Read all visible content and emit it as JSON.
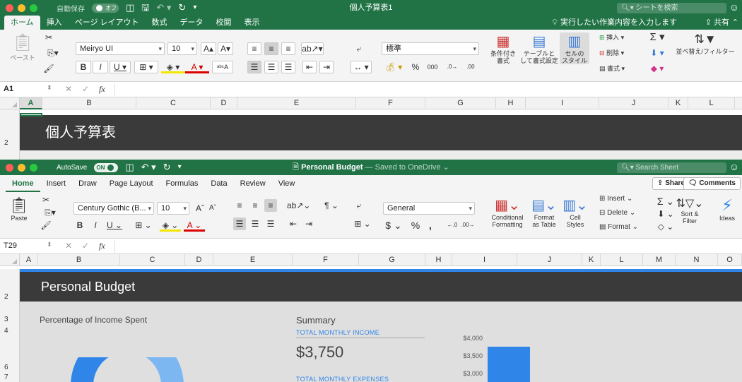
{
  "window_jp": {
    "autosave_label": "自動保存",
    "autosave_state": "オフ",
    "title": "個人予算表1",
    "search_placeholder": "シートを検索",
    "tabs": [
      "ホーム",
      "挿入",
      "ページ レイアウト",
      "数式",
      "データ",
      "校閲",
      "表示"
    ],
    "tell_me": "実行したい作業内容を入力します",
    "share": "共有",
    "ribbon": {
      "paste": "ペースト",
      "font_name": "Meiryo UI",
      "font_size": "10",
      "number_format": "標準",
      "percent": "%",
      "thousands": "000",
      "cond_format": [
        "条件付き",
        "書式"
      ],
      "format_table": [
        "テーブルと",
        "して書式設定"
      ],
      "cell_styles": [
        "セルの",
        "スタイル"
      ],
      "insert": "挿入",
      "delete": "削除",
      "format": "書式",
      "sort_filter": "並べ替え/フィルター"
    },
    "name_box": "A1",
    "columns": [
      "A",
      "B",
      "C",
      "D",
      "E",
      "F",
      "G",
      "H",
      "I",
      "J",
      "K",
      "L"
    ],
    "row_numbers": [
      "2"
    ],
    "banner_title": "個人予算表"
  },
  "window_en": {
    "autosave_label": "AutoSave",
    "autosave_state": "ON",
    "title": "Personal Budget",
    "title_suffix": "— Saved to OneDrive",
    "search_placeholder": "Search Sheet",
    "tabs": [
      "Home",
      "Insert",
      "Draw",
      "Page Layout",
      "Formulas",
      "Data",
      "Review",
      "View"
    ],
    "share": "Share",
    "comments": "Comments",
    "ribbon": {
      "paste": "Paste",
      "font_name": "Century Gothic (B...",
      "font_size": "10",
      "number_format": "General",
      "currency": "$",
      "percent": "%",
      "comma": ",",
      "cond_format": [
        "Conditional",
        "Formatting"
      ],
      "format_table": [
        "Format",
        "as Table"
      ],
      "cell_styles": [
        "Cell",
        "Styles"
      ],
      "insert": "Insert",
      "delete": "Delete",
      "format": "Format",
      "sort_filter": [
        "Sort &",
        "Filter"
      ],
      "ideas": "Ideas"
    },
    "name_box": "T29",
    "columns": [
      "A",
      "B",
      "C",
      "D",
      "E",
      "F",
      "G",
      "H",
      "I",
      "J",
      "K",
      "L",
      "M",
      "N",
      "O"
    ],
    "row_numbers": [
      "2",
      "3",
      "4",
      "6",
      "7"
    ],
    "banner_title": "Personal Budget",
    "donut_title": "Percentage of Income Spent",
    "summary_title": "Summary",
    "income_label": "TOTAL MONTHLY INCOME",
    "income_value": "$3,750",
    "expenses_label": "TOTAL MONTHLY EXPENSES",
    "chart_ticks": [
      "$4,000",
      "$3,500",
      "$3,000"
    ]
  },
  "colors": {
    "excel_green": "#217346",
    "accent_blue": "#2f86e8",
    "banner": "#3a3a3a"
  }
}
